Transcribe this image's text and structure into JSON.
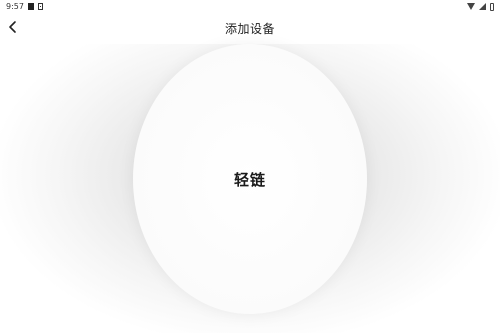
{
  "status_bar": {
    "time": "9:57"
  },
  "header": {
    "title": "添加设备",
    "back_icon": "chevron-left-icon"
  },
  "main": {
    "primary_action_label": "轻链"
  },
  "colors": {
    "background": "#ffffff",
    "text": "#1a1a1a",
    "halo": "#dcdcdc"
  }
}
